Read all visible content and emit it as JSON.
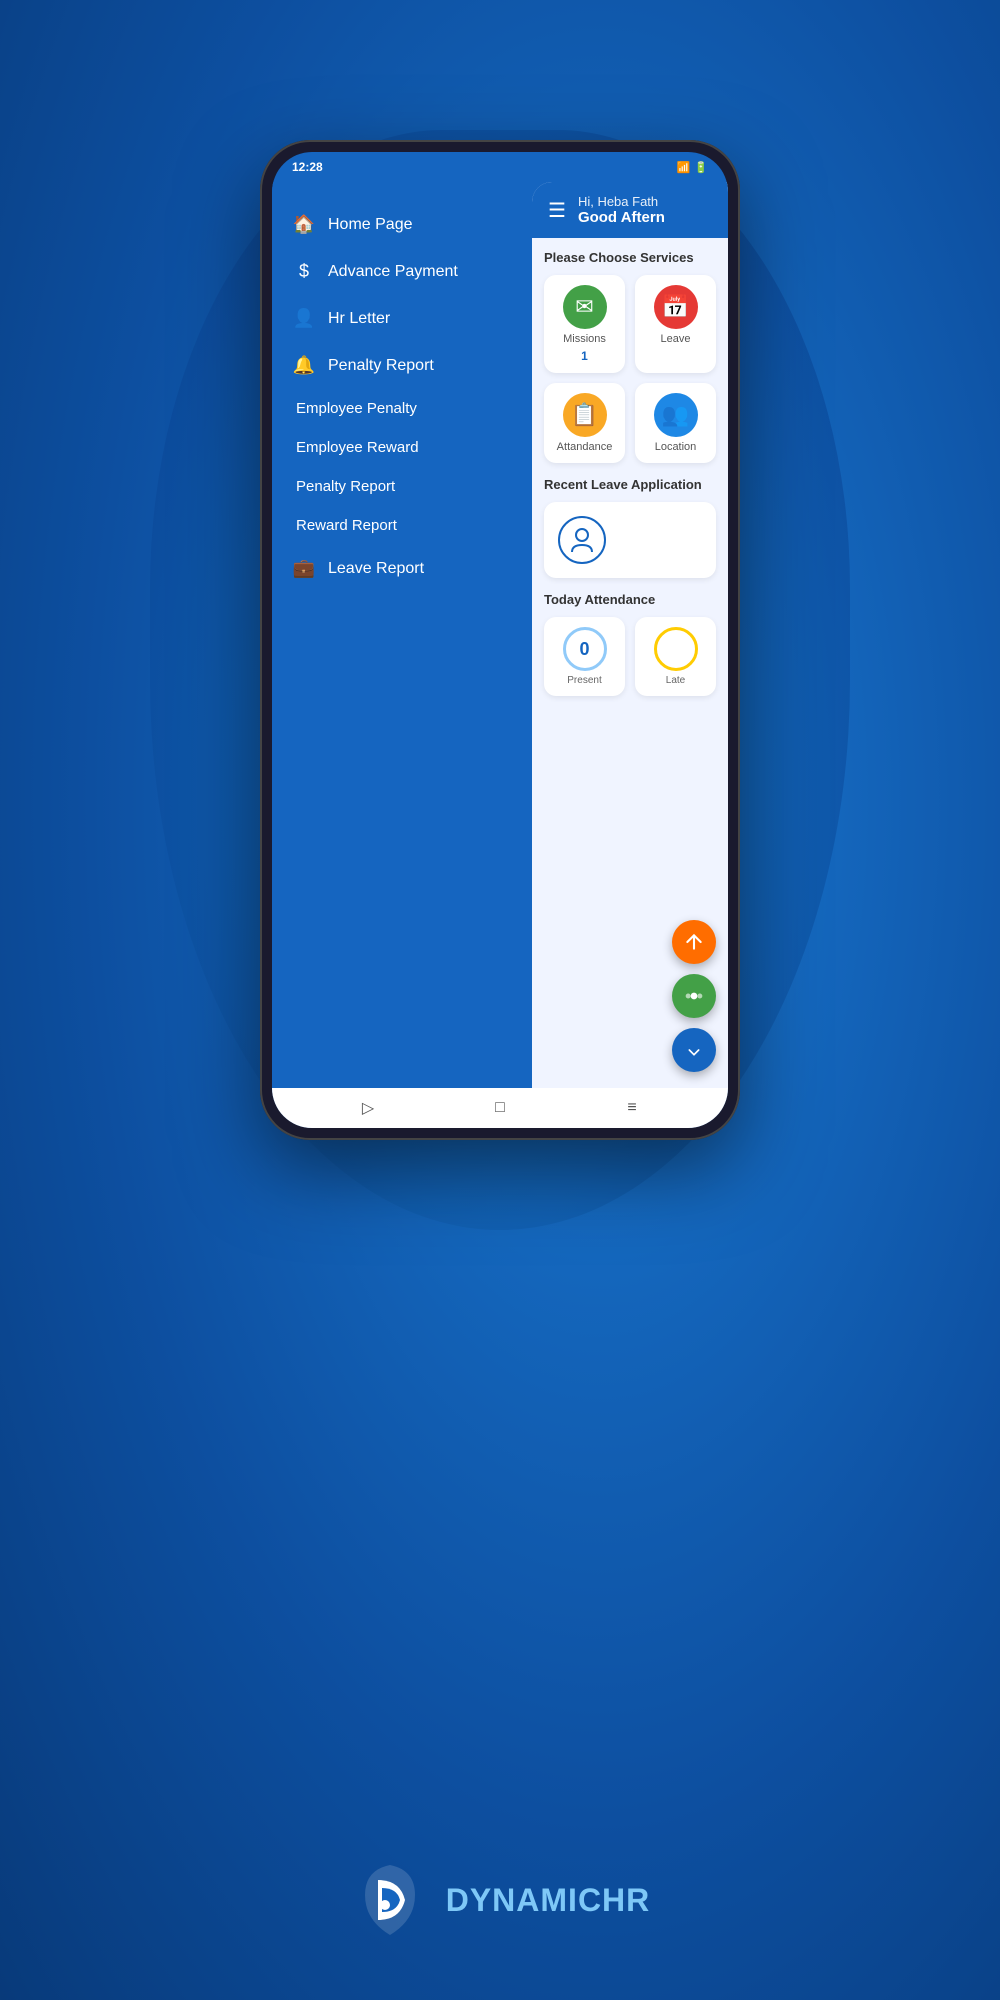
{
  "statusBar": {
    "time": "12:28",
    "batteryIcon": "🔋",
    "signalIcon": "📶"
  },
  "sidebar": {
    "items": [
      {
        "id": "home-page",
        "label": "Home Page",
        "icon": "🏠"
      },
      {
        "id": "advance-payment",
        "label": "Advance Payment",
        "icon": "$"
      },
      {
        "id": "hr-letter",
        "label": "Hr Letter",
        "icon": "👤"
      },
      {
        "id": "penalty-report",
        "label": "Penalty Report",
        "icon": "🔔"
      }
    ],
    "subItems": [
      {
        "id": "employee-penalty",
        "label": "Employee Penalty"
      },
      {
        "id": "employee-reward",
        "label": "Employee Reward"
      },
      {
        "id": "penalty-report-sub",
        "label": "Penalty Report"
      },
      {
        "id": "reward-report",
        "label": "Reward Report"
      },
      {
        "id": "leave-report",
        "label": "Leave Report",
        "icon": "💼"
      }
    ]
  },
  "mainPanel": {
    "greeting": "Hi, Heba Fath",
    "subGreeting": "Good Aftern",
    "servicesTitle": "Please Choose Services",
    "services": [
      {
        "id": "missions",
        "label": "Missions",
        "badge": "1",
        "color": "#43a047",
        "icon": "✉"
      },
      {
        "id": "leave",
        "label": "Lea",
        "color": "#e53935",
        "icon": "📅"
      },
      {
        "id": "attendance",
        "label": "Attandance",
        "badge": "",
        "color": "#f9a825",
        "icon": "📋"
      },
      {
        "id": "location",
        "label": "Lo",
        "color": "#1e88e5",
        "icon": "👥"
      }
    ],
    "recentLeaveTitle": "Recent Leave Application",
    "todayAttendanceTitle": "Today Attendance",
    "attendance": [
      {
        "id": "present",
        "label": "Present",
        "value": "0",
        "colorClass": "blue"
      },
      {
        "id": "late",
        "label": "La",
        "value": "",
        "colorClass": "yellow"
      }
    ]
  },
  "homeBar": {
    "backBtn": "▷",
    "homeBtn": "□",
    "menuBtn": "≡"
  },
  "brand": {
    "logoAlt": "Dynamic HR Logo",
    "name": "DYNAMIC",
    "nameAccent": "HR"
  }
}
